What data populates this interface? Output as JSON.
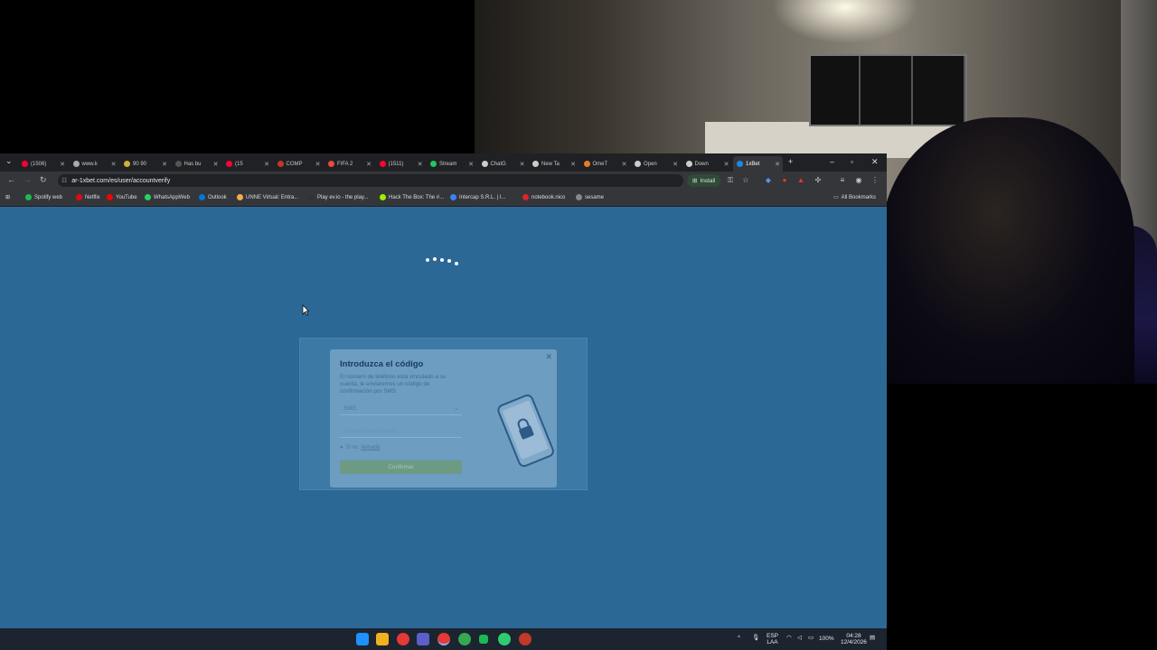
{
  "tabs": [
    {
      "label": "(1506)",
      "favicon_color": "#ff0033"
    },
    {
      "label": "www.k",
      "favicon_color": "#aaaaaa"
    },
    {
      "label": "90 90",
      "favicon_color": "#d4af37"
    },
    {
      "label": "Has bu",
      "favicon_color": "#555555"
    },
    {
      "label": "(15",
      "favicon_color": "#ff0033"
    },
    {
      "label": "COMP",
      "favicon_color": "#c0392b"
    },
    {
      "label": "FIFA 2",
      "favicon_color": "#e74c3c"
    },
    {
      "label": "(1511)",
      "favicon_color": "#ff0033"
    },
    {
      "label": "Stream",
      "favicon_color": "#22c55e"
    },
    {
      "label": "ChatG",
      "favicon_color": "#cccccc"
    },
    {
      "label": "New Ta",
      "favicon_color": "#cccccc"
    },
    {
      "label": "OmeT",
      "favicon_color": "#e67e22"
    },
    {
      "label": "Open",
      "favicon_color": "#cccccc"
    },
    {
      "label": "Down",
      "favicon_color": "#cccccc"
    },
    {
      "label": "1xBet",
      "favicon_color": "#1e88e5",
      "active": true
    }
  ],
  "address": {
    "url": "ar-1xbet.com/es/user/accountverify",
    "install_label": "Install"
  },
  "bookmarks": [
    {
      "label": "Spotify web",
      "color": "#1db954"
    },
    {
      "label": "Netflix",
      "color": "#e50914"
    },
    {
      "label": "YouTube",
      "color": "#ff0000"
    },
    {
      "label": "WhatsAppWeb",
      "color": "#25d366"
    },
    {
      "label": "Outlook",
      "color": "#0078d4"
    },
    {
      "label": "UNNE Virtual: Entra...",
      "color": "#f0ad4e"
    },
    {
      "label": "Play ev.io - the play...",
      "color": "#333333"
    },
    {
      "label": "Hack The Box: The #...",
      "color": "#9fef00"
    },
    {
      "label": "Intercap S.R.L. | I...",
      "color": "#3b82f6"
    },
    {
      "label": "notebook.nico",
      "color": "#dc2626"
    },
    {
      "label": "sesame",
      "color": "#888888"
    }
  ],
  "all_bookmarks_label": "All Bookmarks",
  "modal": {
    "title": "Introduzca el código",
    "description": "El número de teléfono está vinculado a su cuenta, le enviaremos un código de confirmación por SMS",
    "method_value": "SMS",
    "code_placeholder": "Introduzca el código",
    "resend_prefix": "Si no",
    "resend_link": "llamada",
    "confirm_label": "Confirmar"
  },
  "taskbar": {
    "lang": "ESP",
    "lang_sub": "LAA",
    "battery": "100%",
    "time": "04:28",
    "date": "12/4/2026"
  }
}
